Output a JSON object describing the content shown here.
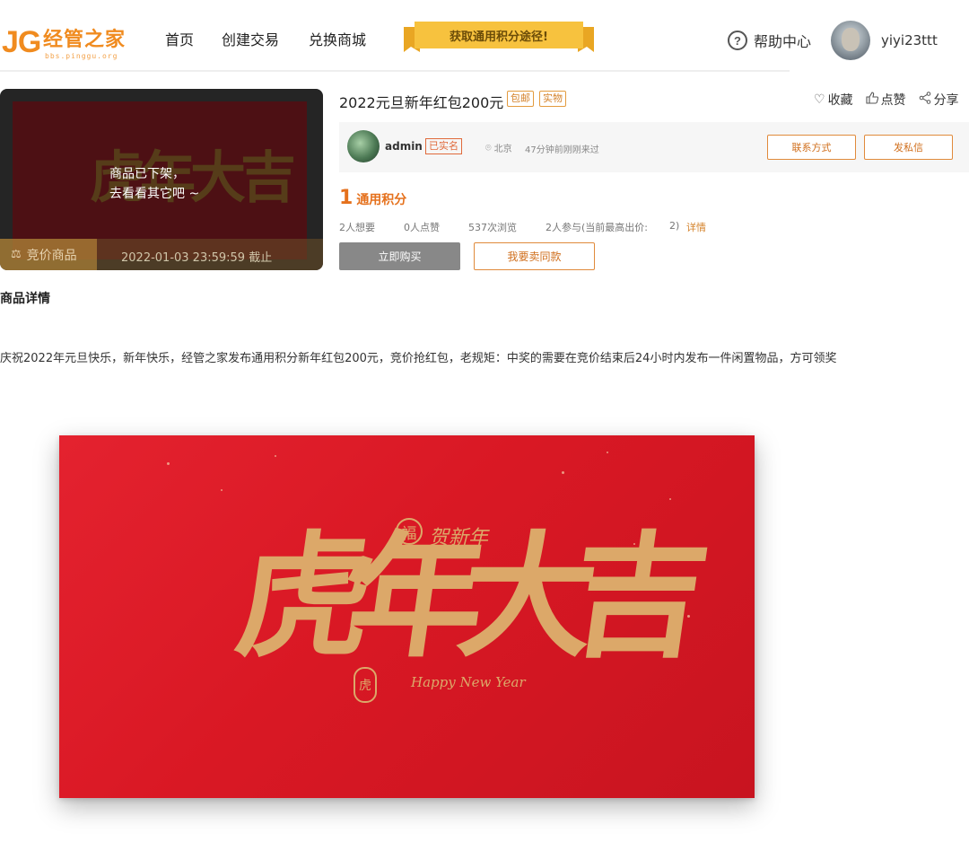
{
  "header": {
    "logo_mark": "JG",
    "logo_name": "经管之家",
    "logo_sub": "bbs.pinggu.org",
    "nav": [
      "首页",
      "创建交易",
      "兑换商城"
    ],
    "banner": "获取通用积分途径!",
    "help_label": "帮助中心",
    "username": "yiyi23ttt"
  },
  "product": {
    "thumb_status_line1": "商品已下架，",
    "thumb_status_line2": "去看看其它吧 ~",
    "thumb_tag": "竞价商品",
    "thumb_deadline": "2022-01-03 23:59:59 截止",
    "title": "2022元旦新年红包200元",
    "badges": [
      "包邮",
      "实物"
    ],
    "actions": {
      "favorite": "收藏",
      "like": "点赞",
      "share": "分享"
    },
    "seller": {
      "name": "admin",
      "verified": "已实名",
      "location": "北京",
      "last_seen": "47分钟前刚刚来过",
      "contact_button": "联系方式",
      "message_button": "发私信"
    },
    "price_value": "1",
    "price_unit": "通用积分",
    "stats": {
      "wants": "2人想要",
      "likes": "0人点赞",
      "views": "537次浏览",
      "bids": "2人参与(当前最高出价:",
      "bid_value": "2)",
      "details_link": "详情"
    },
    "buy_button": "立即购买",
    "sell_same_button": "我要卖同款"
  },
  "detail": {
    "title": "商品详情",
    "description": "庆祝2022年元旦快乐，新年快乐，经管之家发布通用积分新年红包200元，竞价抢红包，老规矩：中奖的需要在竞价结束后24小时内发布一件闲置物品，方可领奖",
    "card_calligraphy": "虎年大吉",
    "card_fu": "福",
    "card_greeting": "贺新年",
    "card_english": "Happy New Year",
    "card_seal": "虎"
  },
  "colors": {
    "brand": "#f08b1f",
    "accent": "#e5711d",
    "card_red": "#d91824",
    "gold": "#dca869"
  }
}
